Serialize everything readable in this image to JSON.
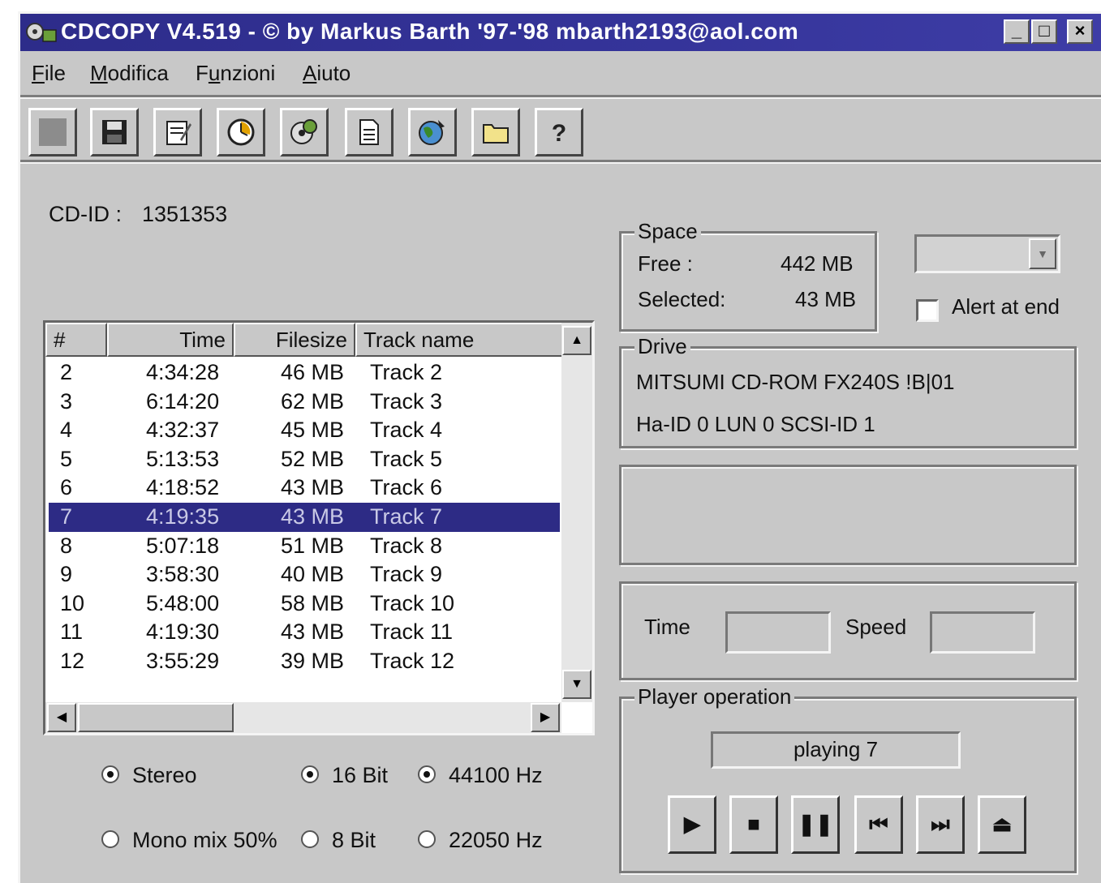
{
  "window": {
    "title": "CDCOPY  V4.519  - © by Markus Barth '97-'98 mbarth2193@aol.com",
    "controls": [
      "_",
      "□",
      "×"
    ]
  },
  "menu": [
    {
      "label": "File",
      "underline": "F",
      "rest": "ile"
    },
    {
      "label": "Modifica",
      "underline": "M",
      "rest": "odifica"
    },
    {
      "label": "Funzioni",
      "pre": "F",
      "underline": "u",
      "rest": "nzioni"
    },
    {
      "label": "Aiuto",
      "underline": "A",
      "rest": "iuto"
    }
  ],
  "toolbar": [
    "stop-icon",
    "save-icon",
    "edit-icon",
    "clock-icon",
    "cd-icon",
    "document-icon",
    "globe-icon",
    "folder-icon",
    "help-icon"
  ],
  "cd_id": {
    "label": "CD-ID :",
    "value": "1351353"
  },
  "tracklist": {
    "headers": {
      "num": "#",
      "time": "Time",
      "size": "Filesize",
      "name": "Track name"
    },
    "rows": [
      {
        "num": "2",
        "time": "4:34:28",
        "size": "46 MB",
        "name": "Track  2"
      },
      {
        "num": "3",
        "time": "6:14:20",
        "size": "62 MB",
        "name": "Track  3"
      },
      {
        "num": "4",
        "time": "4:32:37",
        "size": "45 MB",
        "name": "Track  4"
      },
      {
        "num": "5",
        "time": "5:13:53",
        "size": "52 MB",
        "name": "Track  5"
      },
      {
        "num": "6",
        "time": "4:18:52",
        "size": "43 MB",
        "name": "Track  6"
      },
      {
        "num": "7",
        "time": "4:19:35",
        "size": "43 MB",
        "name": "Track  7",
        "selected": true
      },
      {
        "num": "8",
        "time": "5:07:18",
        "size": "51 MB",
        "name": "Track  8"
      },
      {
        "num": "9",
        "time": "3:58:30",
        "size": "40 MB",
        "name": "Track  9"
      },
      {
        "num": "10",
        "time": "5:48:00",
        "size": "58 MB",
        "name": "Track 10"
      },
      {
        "num": "11",
        "time": "4:19:30",
        "size": "43 MB",
        "name": "Track 11"
      },
      {
        "num": "12",
        "time": "3:55:29",
        "size": "39 MB",
        "name": "Track 12"
      }
    ]
  },
  "audio_options": {
    "stereo": "Stereo",
    "mono": "Mono mix 50%",
    "bit16": "16 Bit",
    "bit8": "8 Bit",
    "hz44": "44100 Hz",
    "hz22": "22050 Hz"
  },
  "space": {
    "label": "Space",
    "free_label": "Free :",
    "free_value": "442 MB",
    "selected_label": "Selected:",
    "selected_value": "43 MB"
  },
  "alert": {
    "label": "Alert at end",
    "checked": false
  },
  "drive": {
    "label": "Drive",
    "line1": "MITSUMI CD-ROM FX240S !B|01",
    "line2": "Ha-ID 0 LUN 0 SCSI-ID 1"
  },
  "timing": {
    "time_label": "Time",
    "speed_label": "Speed"
  },
  "player": {
    "label": "Player operation",
    "status": "playing 7",
    "buttons": [
      "play-icon",
      "stop-icon",
      "pause-icon",
      "previous-track-icon",
      "next-track-icon",
      "eject-icon"
    ]
  }
}
